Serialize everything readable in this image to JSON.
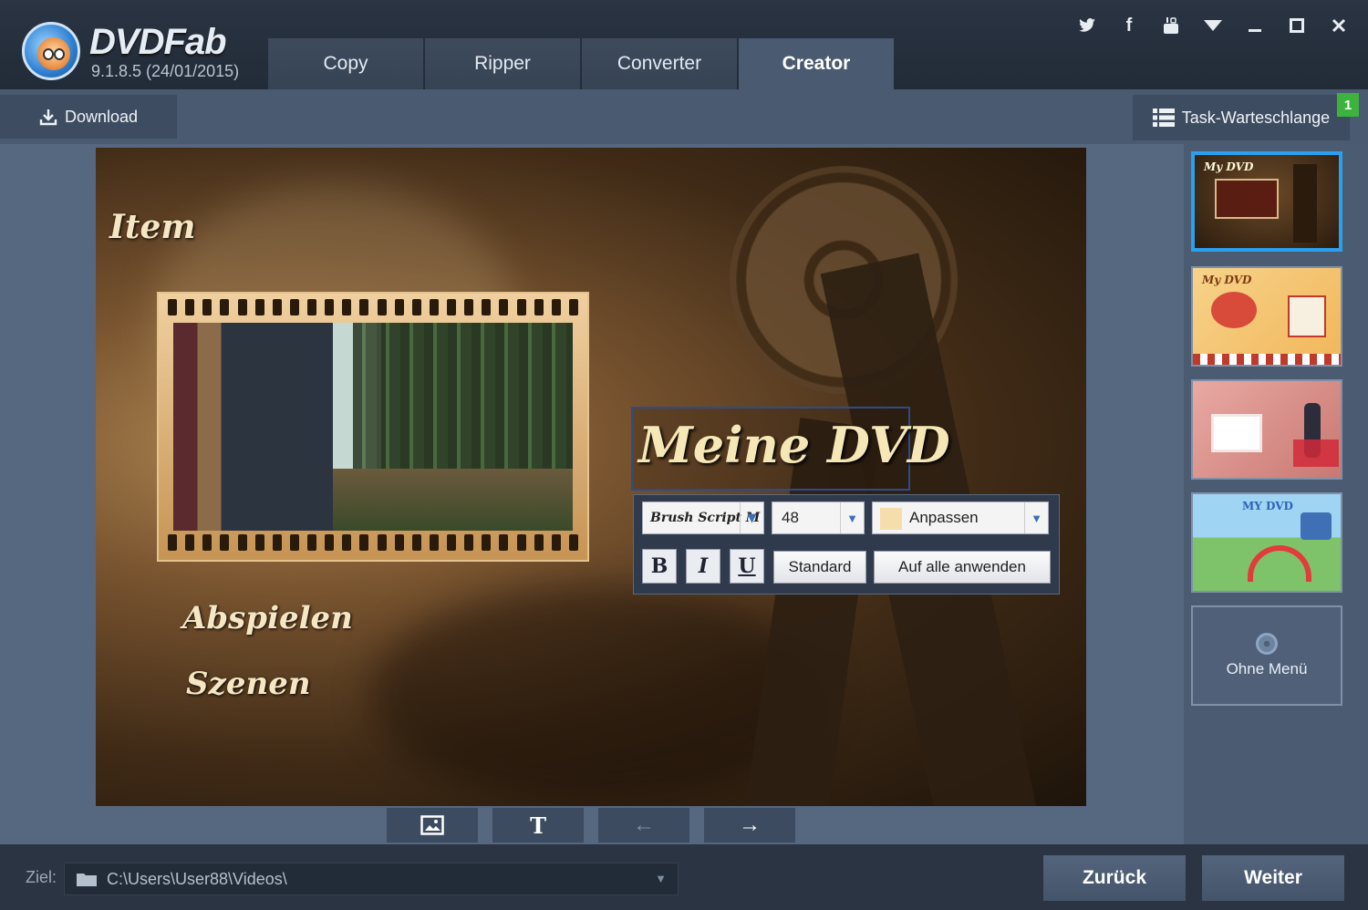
{
  "app": {
    "brand": "DVDFab",
    "version": "9.1.8.5 (24/01/2015)"
  },
  "tabs": [
    {
      "label": "Copy",
      "active": false
    },
    {
      "label": "Ripper",
      "active": false
    },
    {
      "label": "Converter",
      "active": false
    },
    {
      "label": "Creator",
      "active": true
    }
  ],
  "window_controls": [
    "twitter-icon",
    "facebook-icon",
    "youtube-icon",
    "dropdown-icon",
    "minimize-icon",
    "maximize-icon",
    "close-icon"
  ],
  "toolbar": {
    "download_label": "Download",
    "task_queue_label": "Task-Warteschlange",
    "task_count": "1"
  },
  "menu_preview": {
    "item_label": "Item",
    "title_text": "Meine DVD",
    "play_label": "Abspielen",
    "scenes_label": "Szenen"
  },
  "font_panel": {
    "font_name": "Brush Script M",
    "font_size": "48",
    "color_mode": "Anpassen",
    "bold_label": "B",
    "italic_label": "I",
    "underline_label": "U",
    "standard_label": "Standard",
    "apply_all_label": "Auf alle anwenden"
  },
  "preview_tools": [
    {
      "icon": "image-icon",
      "glyph": "▣"
    },
    {
      "icon": "text-icon",
      "glyph": "T"
    },
    {
      "icon": "back-arrow-icon",
      "glyph": "←"
    },
    {
      "icon": "forward-arrow-icon",
      "glyph": "→"
    }
  ],
  "templates": [
    {
      "label": "My DVD",
      "selected": true
    },
    {
      "label": "My DVD",
      "selected": false
    },
    {
      "label": "",
      "selected": false
    },
    {
      "label": "MY DVD",
      "selected": false
    }
  ],
  "no_menu_label": "Ohne Menü",
  "bottom": {
    "target_label": "Ziel:",
    "target_path": "C:\\Users\\User88\\Videos\\",
    "back_label": "Zurück",
    "next_label": "Weiter"
  },
  "colors": {
    "accent_selected": "#2aa0ee",
    "badge_green": "#3cb33c"
  }
}
